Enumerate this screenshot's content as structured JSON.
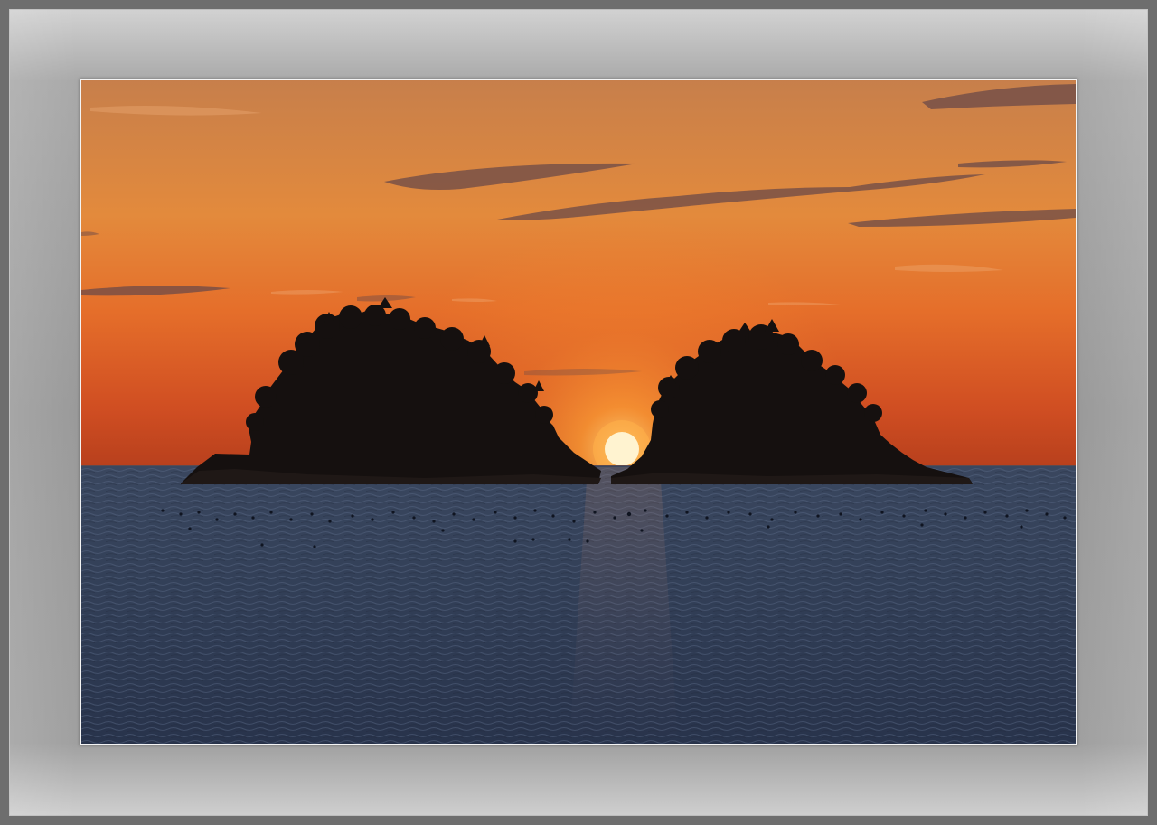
{
  "scene": {
    "subject": "sunset-between-two-islands",
    "colors": {
      "sky_top": "#c9814a",
      "sky_mid": "#e8842f",
      "sky_horizon": "#c2481f",
      "sun_glow": "#ff9a2a",
      "sun_core": "#fff6d8",
      "island": "#14100f",
      "sea_top": "#3c4a63",
      "sea_bottom": "#27324a",
      "frame_mat": "#a9a9a9",
      "frame_outer": "#6e6e6e"
    }
  }
}
